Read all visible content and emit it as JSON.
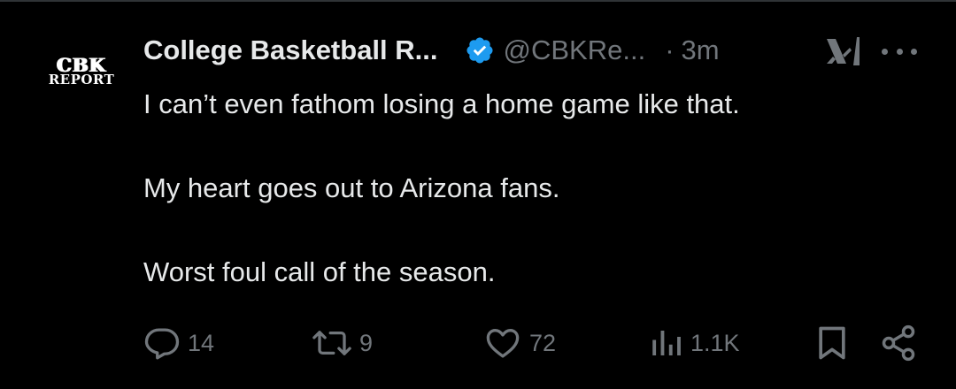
{
  "tweet": {
    "avatar": {
      "line1": "CBK",
      "line2": "REPORT"
    },
    "author_name": "College Basketball R...",
    "handle": "@CBKRe...",
    "separator": "·",
    "time": "3m",
    "lines": [
      "I can’t even fathom losing a home game like that.",
      "My heart goes out to Arizona fans.",
      "Worst foul call of the season."
    ]
  },
  "actions": {
    "replies": "14",
    "reposts": "9",
    "likes": "72",
    "views": "1.1K"
  },
  "icons": {
    "verified": "verified-badge-icon",
    "grok": "grok-icon",
    "more": "more-dots-icon",
    "reply": "reply-icon",
    "repost": "repost-icon",
    "like": "heart-icon",
    "views": "views-icon",
    "bookmark": "bookmark-icon",
    "share": "share-icon"
  },
  "colors": {
    "background": "#000000",
    "text": "#e7e9ea",
    "muted": "#71767b",
    "verified": "#1d9bf0"
  }
}
